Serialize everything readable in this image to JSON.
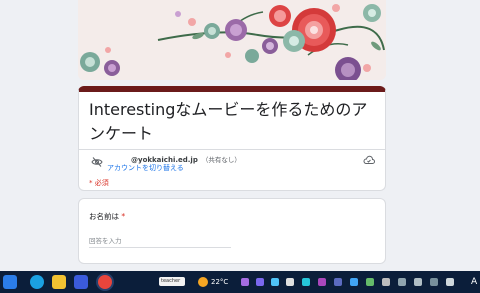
{
  "form": {
    "title": "Interestingなムービーを作るためのアンケート",
    "email_account": "@yokkaichi.ed.jp",
    "share_note": "（共有なし）",
    "switch_account": "アカウントを切り替える",
    "required_note": "* 必須"
  },
  "question": {
    "label": "お名前は",
    "required_mark": " *",
    "placeholder": "回答を入力"
  },
  "taskbar": {
    "search_text": "teacher",
    "temperature": "22°C",
    "language": "A",
    "accent": "#0b1e3a"
  },
  "colors": {
    "theme": "#6b1b1b",
    "required": "#d93025",
    "link": "#1a73e8"
  }
}
